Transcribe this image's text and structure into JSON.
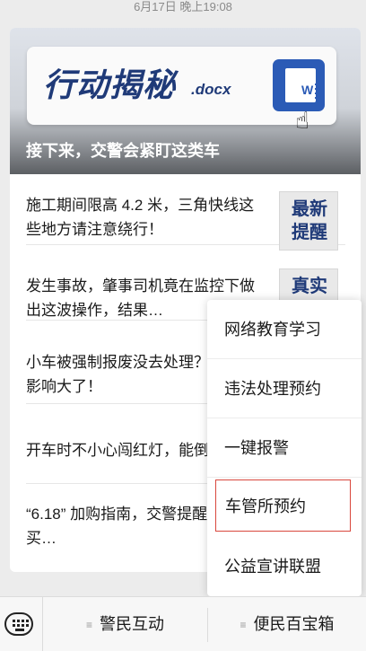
{
  "timestamp": "6月17日 晚上19:08",
  "banner": {
    "doc_title": "行动揭秘",
    "doc_ext": ".docx",
    "word_letter": "W",
    "caption": "接下来，交警会紧盯这类车"
  },
  "articles": [
    {
      "text": "施工期间限高 4.2 米，三角快线这些地方请注意绕行！",
      "thumb": "最新提醒"
    },
    {
      "text": "发生事故，肇事司机竟在监控下做出这波操作，结果…",
      "thumb": "真实"
    },
    {
      "text": "小车被强制报废没去处理？交警：影响大了！"
    },
    {
      "text": "开车时不小心闯红灯，能倒"
    },
    {
      "text": "“6.18” 加购指南，交警提醒买…"
    }
  ],
  "popup_menu": {
    "items": [
      "网络教育学习",
      "违法处理预约",
      "一键报警",
      "车管所预约",
      "公益宣讲联盟"
    ],
    "highlight_color": "#d9473d"
  },
  "bottom_bar": {
    "keyboard_icon": "keyboard-icon",
    "menus": [
      "警民互动",
      "便民百宝箱"
    ],
    "menu_icon_glyph": "≡"
  }
}
